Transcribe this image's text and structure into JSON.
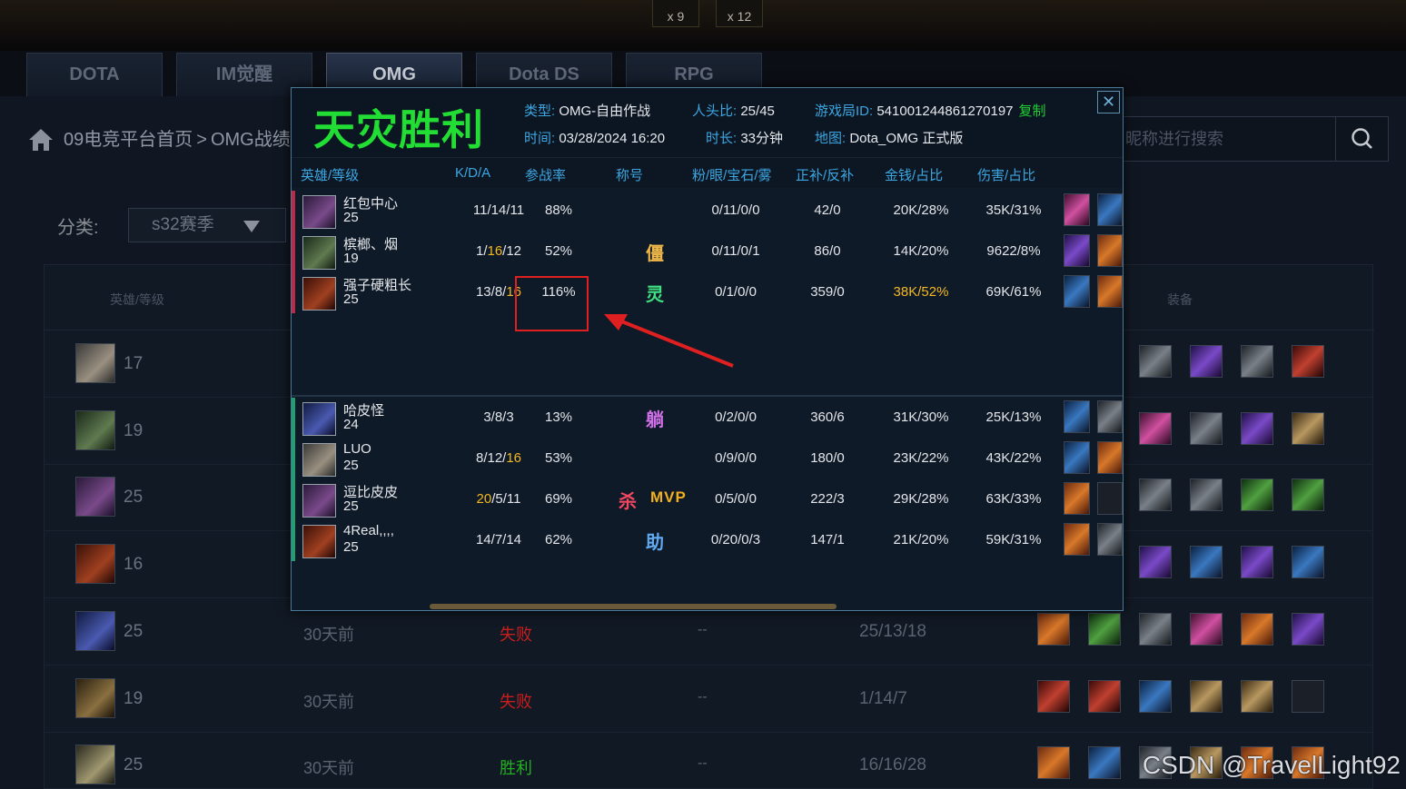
{
  "top_counters": [
    "x 9",
    "x 12"
  ],
  "game_tabs": [
    {
      "label": "DOTA",
      "active": false
    },
    {
      "label": "IM觉醒",
      "active": false
    },
    {
      "label": "OMG",
      "active": true
    },
    {
      "label": "Dota DS",
      "active": false
    },
    {
      "label": "RPG",
      "active": false
    }
  ],
  "breadcrumb": {
    "home": "09电竞平台首页",
    "separator": ">",
    "current": "OMG战绩"
  },
  "search": {
    "placeholder": "昵称进行搜索"
  },
  "filter": {
    "label": "分类:",
    "value": "s32赛季"
  },
  "bg_table": {
    "col_hero": "英雄/等级",
    "col_items": "装备",
    "rows": [
      {
        "level": "17",
        "time": "",
        "result": "",
        "result_color": "",
        "dash": "",
        "kda": "",
        "hero": "hero-a",
        "items": [
          "it-grey",
          "it-purple",
          "it-grey",
          "it-red"
        ]
      },
      {
        "level": "19",
        "time": "",
        "result": "",
        "result_color": "",
        "dash": "",
        "kda": "",
        "hero": "hero-b",
        "items": [
          "it-pink",
          "it-grey",
          "it-purple",
          "it-tan"
        ]
      },
      {
        "level": "25",
        "time": "",
        "result": "",
        "result_color": "",
        "dash": "",
        "kda": "",
        "hero": "hero-c",
        "items": [
          "it-grey",
          "it-grey",
          "it-green",
          "it-green"
        ]
      },
      {
        "level": "16",
        "time": "",
        "result": "",
        "result_color": "",
        "dash": "",
        "kda": "",
        "hero": "hero-d",
        "items": [
          "it-purple",
          "it-blue",
          "it-purple",
          "it-blue"
        ]
      },
      {
        "level": "25",
        "time": "30天前",
        "result": "失败",
        "result_color": "#c81e1e",
        "dash": "--",
        "kda": "25/13/18",
        "hero": "hero-e",
        "items": [
          "it-orange",
          "it-green",
          "it-grey",
          "it-pink",
          "it-orange",
          "it-purple"
        ]
      },
      {
        "level": "19",
        "time": "30天前",
        "result": "失败",
        "result_color": "#c81e1e",
        "dash": "--",
        "kda": "1/14/7",
        "hero": "hero-f",
        "items": [
          "it-red",
          "it-red",
          "it-blue",
          "it-tan",
          "it-tan",
          "it-empty"
        ]
      },
      {
        "level": "25",
        "time": "30天前",
        "result": "胜利",
        "result_color": "#20b020",
        "dash": "--",
        "kda": "16/16/28",
        "hero": "hero-g",
        "items": [
          "it-orange",
          "it-blue",
          "it-grey",
          "it-tan",
          "it-orange",
          "it-orange"
        ]
      }
    ]
  },
  "watermark": "CSDN @TravelLight92",
  "modal": {
    "result": "天灾胜利",
    "meta": {
      "type_label": "类型:",
      "type_value": "OMG-自由作战",
      "heads_label": "人头比:",
      "heads_value": "25/45",
      "gameid_label": "游戏局ID:",
      "gameid_value": "541001244861270197",
      "copy_label": "复制",
      "time_label": "时间:",
      "time_value": "03/28/2024 16:20",
      "duration_label": "时长:",
      "duration_value": "33分钟",
      "map_label": "地图:",
      "map_value": "Dota_OMG 正式版"
    },
    "columns": [
      "英雄/等级",
      "K/D/A",
      "参战率",
      "称号",
      "粉/眼/宝石/雾",
      "正补/反补",
      "金钱/占比",
      "伤害/占比"
    ],
    "close": "✕",
    "team1": [
      {
        "name": "红包中心",
        "level": "25",
        "k": "11",
        "d": "14",
        "a": "11",
        "k_hi": false,
        "a_hi": false,
        "part": "88%",
        "titles": [],
        "wards": "0/11/0/0",
        "cs": "42/0",
        "gold": "20K/28%",
        "gold_hi": false,
        "dmg": "35K/31%",
        "hero": "hero-c",
        "items": [
          "it-pink",
          "it-blue"
        ]
      },
      {
        "name": "槟榔、烟",
        "level": "19",
        "k": "1",
        "d": "16",
        "a": "12",
        "k_hi": false,
        "d_hi": true,
        "a_hi": false,
        "part": "52%",
        "titles": [
          {
            "text": "僵",
            "color": "#f0b848"
          }
        ],
        "wards": "0/11/0/1",
        "cs": "86/0",
        "gold": "14K/20%",
        "gold_hi": false,
        "dmg": "9622/8%",
        "hero": "hero-b",
        "items": [
          "it-purple",
          "it-orange"
        ]
      },
      {
        "name": "强子硬粗长",
        "level": "25",
        "k": "13",
        "d": "8",
        "a": "16",
        "k_hi": false,
        "a_hi": true,
        "part": "116%",
        "titles": [
          {
            "text": "灵",
            "color": "#40e080"
          }
        ],
        "wards": "0/1/0/0",
        "cs": "359/0",
        "gold": "38K/52%",
        "gold_hi": true,
        "dmg": "69K/61%",
        "hero": "hero-d",
        "items": [
          "it-blue",
          "it-orange"
        ]
      }
    ],
    "team2": [
      {
        "name": "哈皮怪",
        "level": "24",
        "k": "3",
        "d": "8",
        "a": "3",
        "k_hi": false,
        "a_hi": false,
        "part": "13%",
        "titles": [
          {
            "text": "躺",
            "color": "#d070e8"
          }
        ],
        "wards": "0/2/0/0",
        "cs": "360/6",
        "gold": "31K/30%",
        "gold_hi": false,
        "dmg": "25K/13%",
        "hero": "hero-e",
        "items": [
          "it-blue",
          "it-grey"
        ]
      },
      {
        "name": "LUO",
        "level": "25",
        "k": "8",
        "d": "12",
        "a": "16",
        "k_hi": false,
        "a_hi": true,
        "part": "53%",
        "titles": [],
        "wards": "0/9/0/0",
        "cs": "180/0",
        "gold": "23K/22%",
        "gold_hi": false,
        "dmg": "43K/22%",
        "hero": "hero-a",
        "items": [
          "it-blue",
          "it-orange"
        ]
      },
      {
        "name": "逗比皮皮",
        "level": "25",
        "k": "20",
        "d": "5",
        "a": "11",
        "k_hi": true,
        "a_hi": false,
        "part": "69%",
        "titles": [
          {
            "text": "杀",
            "color": "#f04860"
          },
          {
            "text": "MVP",
            "color": "#f0b020"
          }
        ],
        "wards": "0/5/0/0",
        "cs": "222/3",
        "gold": "29K/28%",
        "gold_hi": false,
        "dmg": "63K/33%",
        "hero": "hero-c",
        "items": [
          "it-orange",
          "it-empty"
        ]
      },
      {
        "name": "4Real,,,,",
        "level": "25",
        "k": "14",
        "d": "7",
        "a": "14",
        "k_hi": false,
        "a_hi": false,
        "part": "62%",
        "titles": [
          {
            "text": "助",
            "color": "#60a8f0"
          }
        ],
        "wards": "0/20/0/3",
        "cs": "147/1",
        "gold": "21K/20%",
        "gold_hi": false,
        "dmg": "59K/31%",
        "hero": "hero-d",
        "items": [
          "it-orange",
          "it-grey"
        ]
      }
    ]
  },
  "colors": {
    "accent_blue": "#3da6e0",
    "victory_green": "#22dd33",
    "highlight_gold": "#f5b820",
    "annotation_red": "#e02020"
  }
}
